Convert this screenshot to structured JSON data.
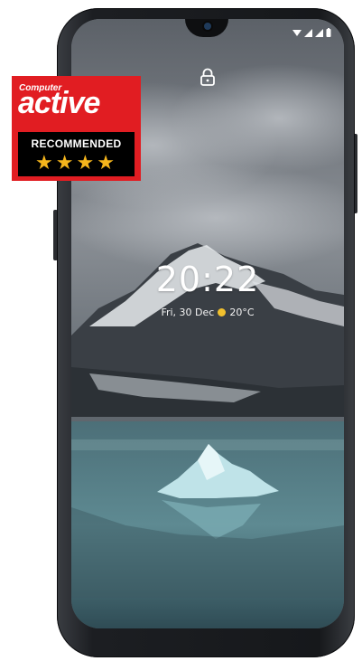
{
  "lockscreen": {
    "time": "20:22",
    "date": "Fri, 30 Dec",
    "weather": "20°C"
  },
  "badge": {
    "brand_small": "Computer",
    "brand_large": "active",
    "label": "RECOMMENDED",
    "stars": "★★★★"
  },
  "icons": {
    "lock": "lock-icon",
    "weather": "sun-icon",
    "status": [
      "wifi-icon",
      "signal-icon",
      "signal-icon",
      "battery-icon"
    ]
  },
  "colors": {
    "badge_red": "#e11d22",
    "star_gold": "#f5b51c",
    "sun": "#f2c12e"
  }
}
